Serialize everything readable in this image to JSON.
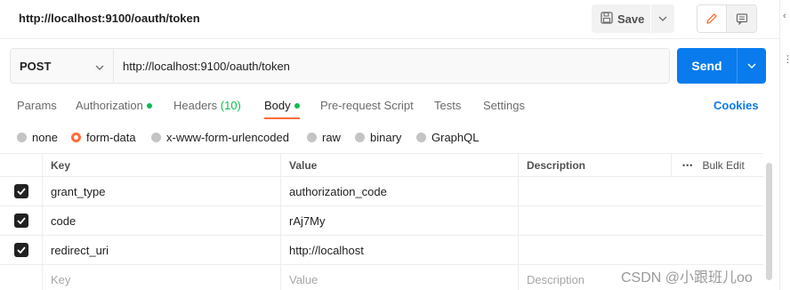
{
  "request": {
    "title": "http://localhost:9100/oauth/token",
    "save_label": "Save",
    "method": "POST",
    "url": "http://localhost:9100/oauth/token",
    "send_label": "Send"
  },
  "tabs": [
    {
      "label": "Params",
      "active": false
    },
    {
      "label": "Authorization",
      "active": false,
      "dot": true
    },
    {
      "label": "Headers",
      "count": "(10)",
      "active": false
    },
    {
      "label": "Body",
      "active": true,
      "dot": true
    },
    {
      "label": "Pre-request Script",
      "active": false
    },
    {
      "label": "Tests",
      "active": false
    },
    {
      "label": "Settings",
      "active": false
    }
  ],
  "cookies_label": "Cookies",
  "body_types": [
    {
      "label": "none",
      "selected": false
    },
    {
      "label": "form-data",
      "selected": true
    },
    {
      "label": "x-www-form-urlencoded",
      "selected": false
    },
    {
      "label": "raw",
      "selected": false
    },
    {
      "label": "binary",
      "selected": false
    },
    {
      "label": "GraphQL",
      "selected": false
    }
  ],
  "table": {
    "headers": {
      "key": "Key",
      "value": "Value",
      "description": "Description",
      "bulk_edit": "Bulk Edit",
      "more": "•••"
    },
    "rows": [
      {
        "checked": true,
        "key": "grant_type",
        "value": "authorization_code",
        "description": ""
      },
      {
        "checked": true,
        "key": "code",
        "value": "rAj7My",
        "description": ""
      },
      {
        "checked": true,
        "key": "redirect_uri",
        "value": "http://localhost",
        "description": ""
      }
    ],
    "placeholders": {
      "key": "Key",
      "value": "Value",
      "description": "Description"
    }
  },
  "watermark": "CSDN @小跟班儿oo",
  "colors": {
    "accent": "#ff6c37",
    "send": "#097bed",
    "dot": "#0cbb52"
  },
  "icons": {
    "save": "floppy-disk-icon",
    "edit": "pencil-icon",
    "doc": "comment-icon"
  }
}
